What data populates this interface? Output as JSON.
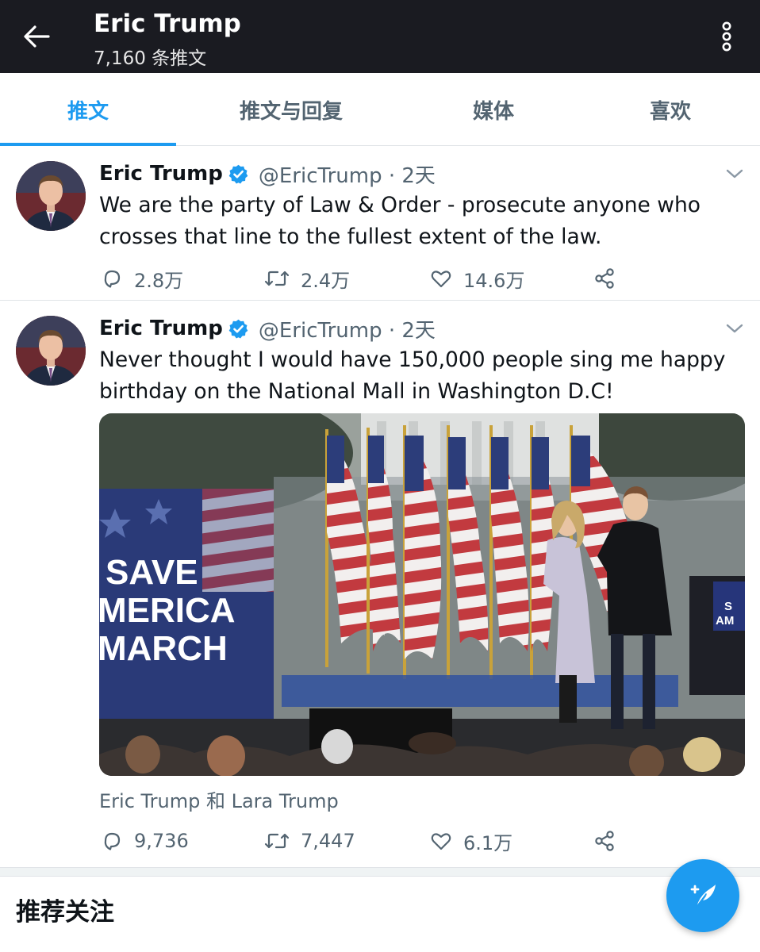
{
  "header": {
    "title": "Eric Trump",
    "subtitle": "7,160 条推文"
  },
  "tabs": [
    {
      "label": "推文",
      "active": true
    },
    {
      "label": "推文与回复",
      "active": false
    },
    {
      "label": "媒体",
      "active": false
    },
    {
      "label": "喜欢",
      "active": false
    }
  ],
  "tweets": [
    {
      "name": "Eric Trump",
      "handle_time": "@EricTrump · 2天",
      "text": "We are the party of Law & Order - prosecute anyone who crosses that line to the fullest extent of the law.",
      "replies": "2.8万",
      "retweets": "2.4万",
      "likes": "14.6万"
    },
    {
      "name": "Eric Trump",
      "handle_time": "@EricTrump · 2天",
      "text": "Never thought I would have 150,000 people sing me happy birthday on the National Mall in Washington D.C!",
      "photo_banner": [
        "SAVE",
        "MERICA",
        "MARCH"
      ],
      "photo_podium": [
        "S",
        "AM"
      ],
      "tagged": "Eric Trump 和 Lara Trump",
      "replies": "9,736",
      "retweets": "7,447",
      "likes": "6.1万"
    }
  ],
  "who_to_follow": {
    "title": "推荐关注"
  },
  "colors": {
    "accent": "#1d9bf0",
    "topbar": "#1a1b21",
    "secondary_text": "#536471"
  },
  "icons": [
    "back-arrow-icon",
    "more-vertical-icon",
    "verified-badge-icon",
    "chevron-down-icon",
    "reply-icon",
    "retweet-icon",
    "like-icon",
    "share-icon",
    "compose-feather-icon"
  ]
}
